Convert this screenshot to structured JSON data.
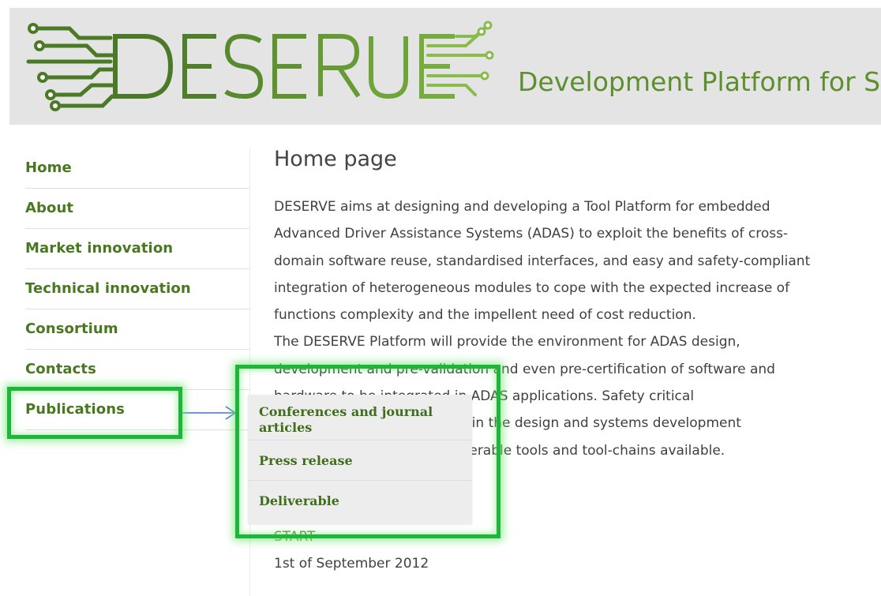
{
  "header": {
    "logo_text": "DESERVE",
    "tagline": "Development Platform for Saf"
  },
  "sidebar": {
    "items": [
      {
        "label": "Home"
      },
      {
        "label": "About"
      },
      {
        "label": "Market innovation"
      },
      {
        "label": "Technical innovation"
      },
      {
        "label": "Consortium"
      },
      {
        "label": "Contacts"
      },
      {
        "label": "Publications"
      }
    ]
  },
  "content": {
    "title": "Home page",
    "paragraph": "DESERVE aims at designing and developing a Tool Platform for embedded\nAdvanced Driver Assistance Systems (ADAS) to exploit the benefits of cross-\ndomain software reuse, standardised interfaces, and easy and safety-compliant\nintegration of heterogeneous modules to cope with the expected increase of\nfunctions complexity and the impellent need of cost reduction.\nThe DESERVE Platform will provide the environment for ADAS design,\ndevelopment and pre-validation and even pre-certification of software and\nhardware to be integrated in ADAS applications. Safety critical\nrequirements are considered in the design and systems development\nthrough well-defined, interoperable tools and tool-chains available.",
    "start_label": "START",
    "start_value": "1st of September 2012"
  },
  "publications_menu": {
    "items": [
      {
        "label": "Conferences and journal articles"
      },
      {
        "label": "Press release"
      },
      {
        "label": "Deliverable"
      }
    ]
  },
  "colors": {
    "brand_green": "#5d8f2e",
    "nav_green": "#48781f",
    "highlight_green": "#1db53a",
    "arrow_blue": "#4a6fc9",
    "header_bg": "#e4e4e4"
  }
}
